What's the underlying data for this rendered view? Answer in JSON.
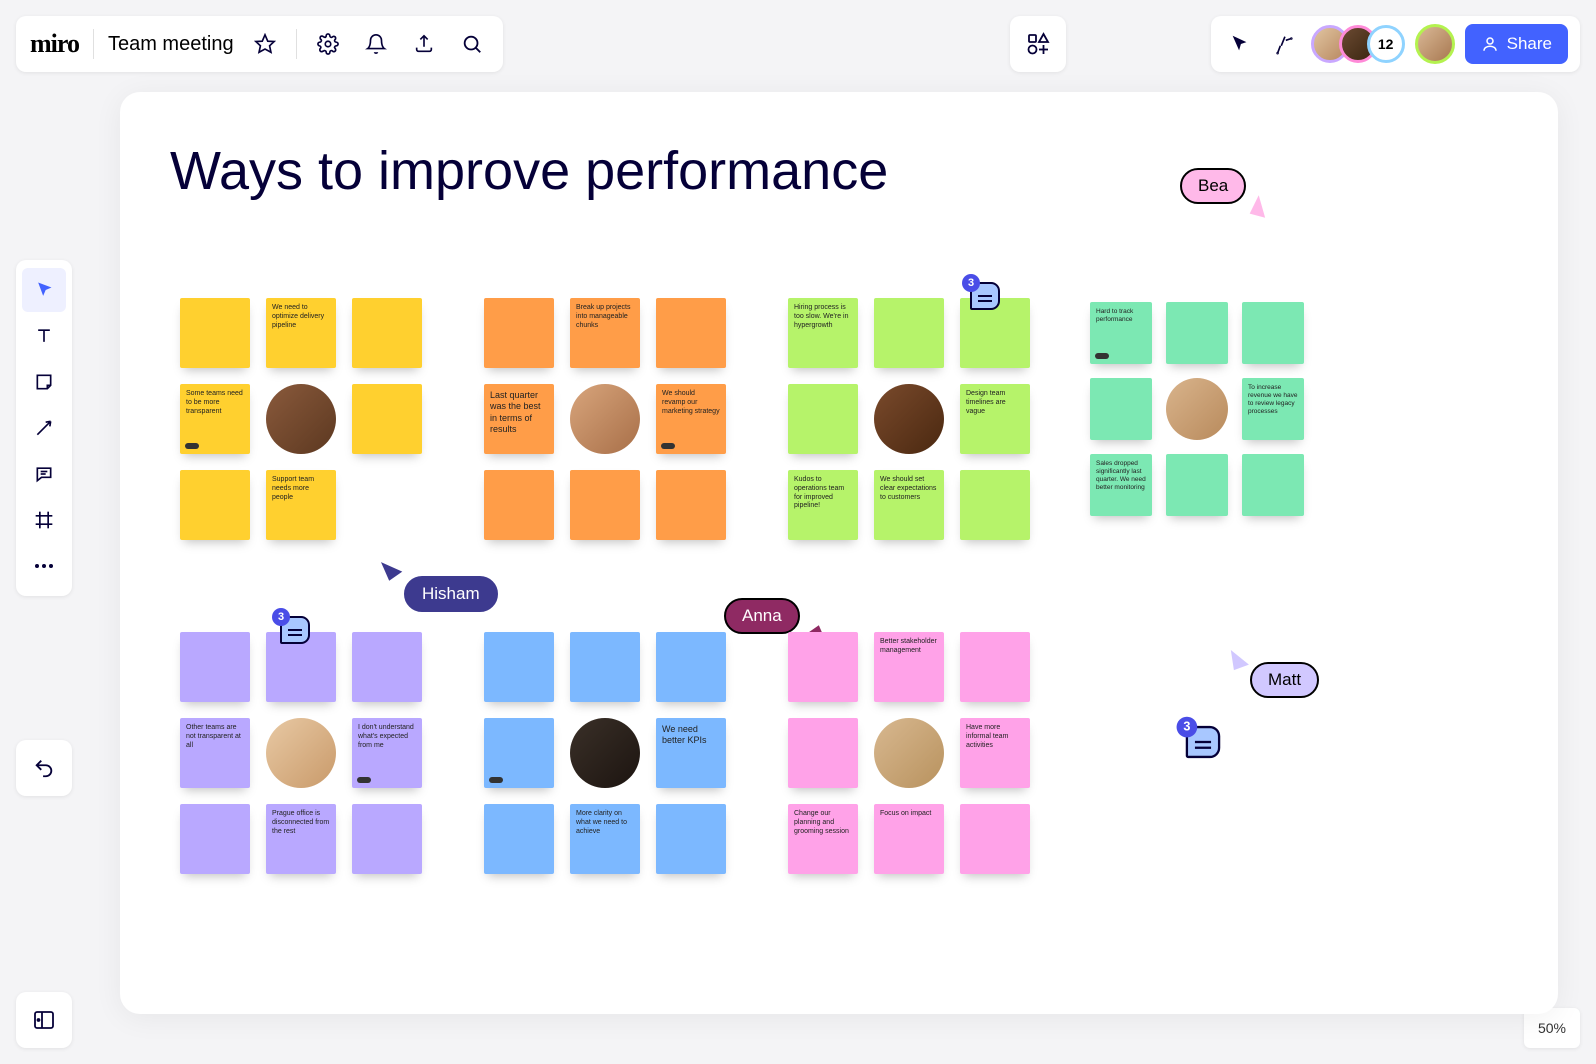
{
  "app": {
    "logo": "miro",
    "board_name": "Team meeting"
  },
  "participants": {
    "overflow_count": "12"
  },
  "share": {
    "label": "Share"
  },
  "zoom": {
    "level": "50%"
  },
  "frame": {
    "title": "Ways to improve performance"
  },
  "colors": {
    "yellow": "#ffd02f",
    "orange": "#ff9d48",
    "lime": "#b6f36a",
    "mint": "#7ce8b3",
    "lilac": "#b9a8ff",
    "sky": "#7cb8ff",
    "pink": "#ffa2e8",
    "hisham_bg": "#3d3a8f",
    "hisham_fg": "#ffffff",
    "anna_bg": "#8f2a63",
    "anna_border": "#000000",
    "anna_fg": "#ffffff",
    "bea_bg": "#ffb9e9",
    "bea_border": "#000000",
    "bea_fg": "#000000",
    "matt_bg": "#d1c8ff",
    "matt_border": "#000000",
    "matt_fg": "#000000"
  },
  "cursors": {
    "hisham": "Hisham",
    "anna": "Anna",
    "bea": "Bea",
    "matt": "Matt"
  },
  "comments": {
    "top": "3",
    "mid": "3",
    "float": "3"
  },
  "clusters": {
    "yellow": {
      "r0c1": "We need to optimize delivery pipeline",
      "r1c0": "Some teams need to be more transparent",
      "r2c1": "Support team needs more people"
    },
    "orange": {
      "r0c1": "Break up projects into manageable chunks",
      "r1c0": "Last quarter was the best in terms of results",
      "r1c2": "We should revamp our marketing strategy"
    },
    "lime": {
      "r0c0": "Hiring process is too slow. We're in hypergrowth",
      "r1c2": "Design team timelines are vague",
      "r2c0": "Kudos to operations team for improved pipeline!",
      "r2c1": "We should set clear expectations to customers"
    },
    "mint": {
      "r0c0": "Hard to track performance",
      "r1c2": "To increase revenue we have to review legacy processes",
      "r2c0": "Sales dropped significantly last quarter. We need better monitoring"
    },
    "lilac": {
      "r1c0": "Other teams are not transparent at all",
      "r1c2": "I don't understand what's expected from me",
      "r2c1": "Prague office is disconnected from the rest"
    },
    "sky": {
      "r1c2": "We need better KPIs",
      "r2c1": "More clarity on what we need to achieve"
    },
    "pink": {
      "r0c1": "Better stakeholder management",
      "r1c2": "Have more informal team activities",
      "r2c0": "Change our planning and grooming session",
      "r2c1": "Focus on impact"
    }
  }
}
